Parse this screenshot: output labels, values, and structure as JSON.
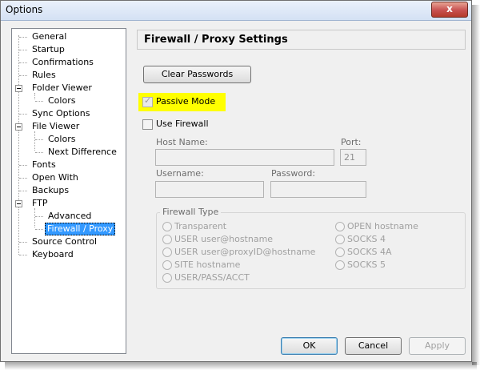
{
  "window": {
    "title": "Options",
    "close_glyph": "x"
  },
  "tree": {
    "items": [
      {
        "label": "General"
      },
      {
        "label": "Startup"
      },
      {
        "label": "Confirmations"
      },
      {
        "label": "Rules"
      },
      {
        "label": "Folder Viewer"
      },
      {
        "label": "Colors"
      },
      {
        "label": "Sync Options"
      },
      {
        "label": "File Viewer"
      },
      {
        "label": "Colors"
      },
      {
        "label": "Next Difference"
      },
      {
        "label": "Fonts"
      },
      {
        "label": "Open With"
      },
      {
        "label": "Backups"
      },
      {
        "label": "FTP"
      },
      {
        "label": "Advanced"
      },
      {
        "label": "Firewall / Proxy"
      },
      {
        "label": "Source Control"
      },
      {
        "label": "Keyboard"
      }
    ],
    "selected": "Firewall / Proxy"
  },
  "panel": {
    "title": "Firewall / Proxy Settings",
    "clear_passwords_label": "Clear Passwords",
    "passive_mode_label": "Passive Mode",
    "passive_mode_checked": true,
    "use_firewall_label": "Use Firewall",
    "use_firewall_checked": false,
    "host_name_label": "Host Name:",
    "host_name_value": "",
    "port_label": "Port:",
    "port_value": "21",
    "username_label": "Username:",
    "username_value": "",
    "password_label": "Password:",
    "password_value": "",
    "firewall_type": {
      "label": "Firewall Type",
      "options_left": [
        "Transparent",
        "USER user@hostname",
        "USER user@proxyID@hostname",
        "SITE hostname",
        "USER/PASS/ACCT"
      ],
      "options_right": [
        "OPEN hostname",
        "SOCKS 4",
        "SOCKS 4A",
        "SOCKS 5"
      ]
    }
  },
  "footer": {
    "ok_label": "OK",
    "cancel_label": "Cancel",
    "apply_label": "Apply"
  },
  "colors": {
    "selection": "#3399ff",
    "highlight": "#ffff00"
  }
}
